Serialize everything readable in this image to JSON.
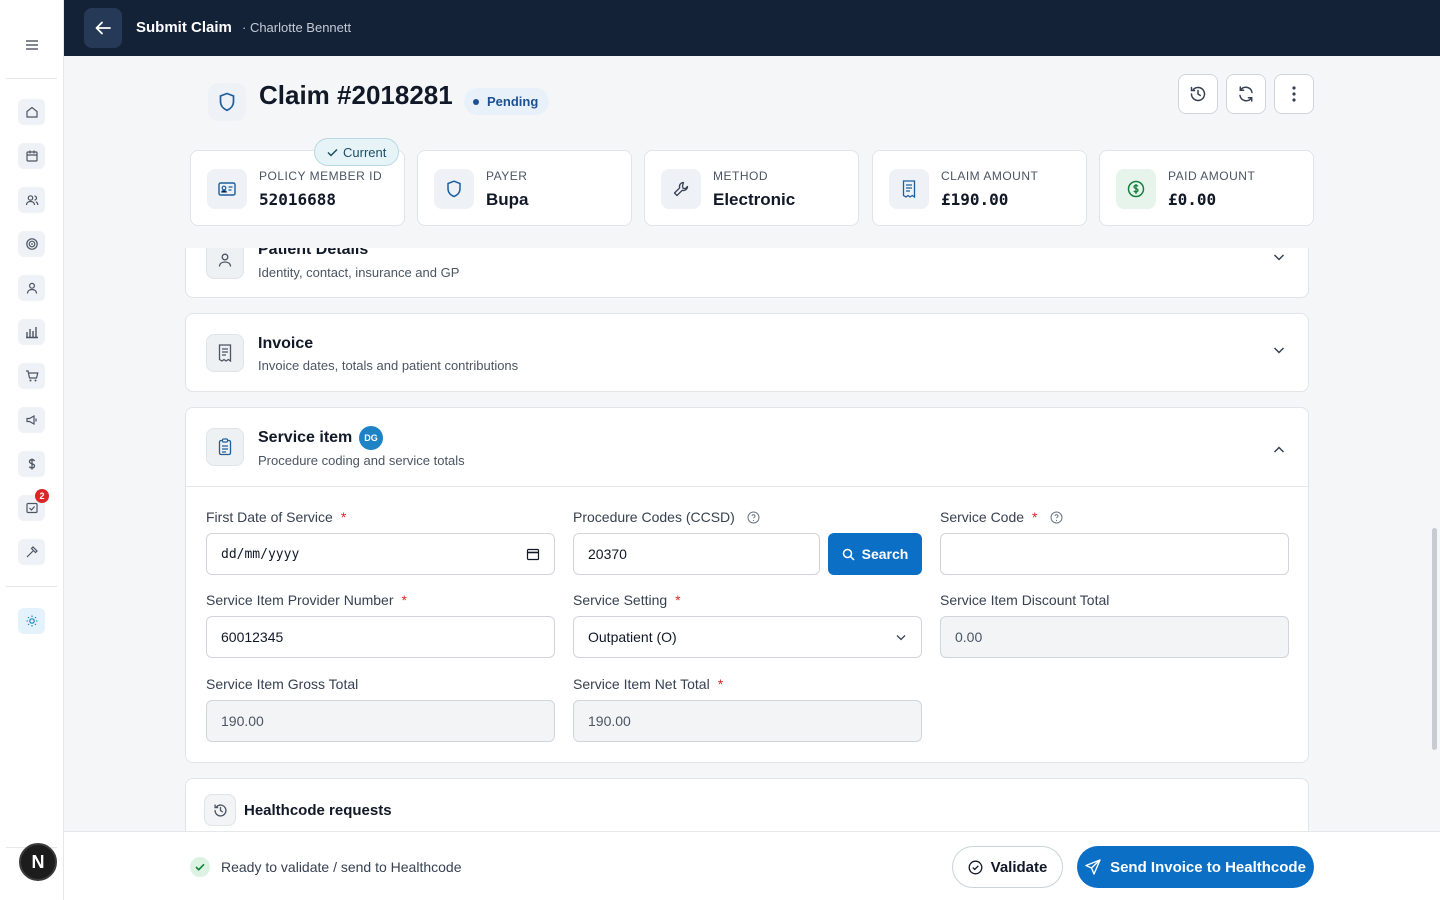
{
  "topbar": {
    "title": "Submit Claim",
    "subtitle": "· Charlotte Bennett"
  },
  "sidebar": {
    "items": [
      {
        "icon": "home-icon"
      },
      {
        "icon": "calendar-icon"
      },
      {
        "icon": "users-icon"
      },
      {
        "icon": "target-icon"
      },
      {
        "icon": "user-icon"
      },
      {
        "icon": "bar-chart-icon"
      },
      {
        "icon": "cart-icon"
      },
      {
        "icon": "megaphone-icon"
      },
      {
        "icon": "dollar-icon"
      },
      {
        "icon": "inbox-icon",
        "badge": "2"
      },
      {
        "icon": "hammer-icon"
      },
      {
        "icon": "sun-icon"
      }
    ],
    "avatar": "N"
  },
  "header": {
    "title": "Claim #2018281",
    "status": "Pending"
  },
  "current_tag": "Current",
  "cards": [
    {
      "label": "POLICY MEMBER ID",
      "value": "52016688",
      "icon": "id-card-icon"
    },
    {
      "label": "PAYER",
      "value": "Bupa",
      "icon": "shield-icon"
    },
    {
      "label": "METHOD",
      "value": "Electronic",
      "icon": "wrench-icon"
    },
    {
      "label": "CLAIM AMOUNT",
      "value": "£190.00",
      "icon": "receipt-icon"
    },
    {
      "label": "PAID AMOUNT",
      "value": "£0.00",
      "icon": "dollar-circle-icon"
    }
  ],
  "sections": {
    "patient": {
      "title": "Patient Details",
      "desc": "Identity, contact, insurance and GP"
    },
    "invoice": {
      "title": "Invoice",
      "desc": "Invoice dates, totals and patient contributions"
    },
    "service": {
      "title": "Service item",
      "badge": "DG",
      "desc": "Procedure coding and service totals"
    },
    "healthcode": {
      "title": "Healthcode requests"
    }
  },
  "form": {
    "first_date": {
      "label": "First Date of Service",
      "placeholder": "dd/mm/yyyy"
    },
    "procedure_codes": {
      "label": "Procedure Codes (CCSD)",
      "value": "20370"
    },
    "search_label": "Search",
    "service_code": {
      "label": "Service Code",
      "value": ""
    },
    "provider_number": {
      "label": "Service Item Provider Number",
      "value": "60012345"
    },
    "service_setting": {
      "label": "Service Setting",
      "value": "Outpatient (O)"
    },
    "discount_total": {
      "label": "Service Item Discount Total",
      "value": "0.00"
    },
    "gross_total": {
      "label": "Service Item Gross Total",
      "value": "190.00"
    },
    "net_total": {
      "label": "Service Item Net Total",
      "value": "190.00"
    }
  },
  "footer": {
    "status": "Ready to validate / send to Healthcode",
    "validate": "Validate",
    "send": "Send Invoice to Healthcode"
  },
  "colors": {
    "navy": "#142238",
    "primary": "#0b6fc6",
    "required": "#dc2626"
  }
}
